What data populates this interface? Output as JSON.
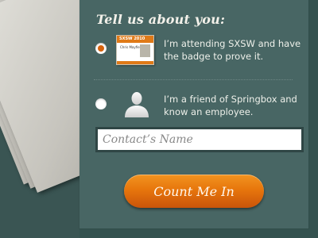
{
  "form": {
    "title": "Tell us about you:",
    "options": [
      {
        "label": "I’m attending SXSW and have the badge to prove it.",
        "checked": true,
        "image": "sxsw-badge-image",
        "badge_header": "SXSW 2010",
        "badge_name": "Chris Mayfield"
      },
      {
        "label": "I’m a friend of Springbox and know an employee.",
        "checked": false,
        "image": "person-silhouette-icon"
      }
    ],
    "contact_name": {
      "placeholder": "Contact’s Name",
      "value": ""
    },
    "submit_label": "Count Me In"
  },
  "colors": {
    "panel": "#486664",
    "background": "#34524f",
    "accent": "#e7760c",
    "text": "#eef0ea"
  }
}
